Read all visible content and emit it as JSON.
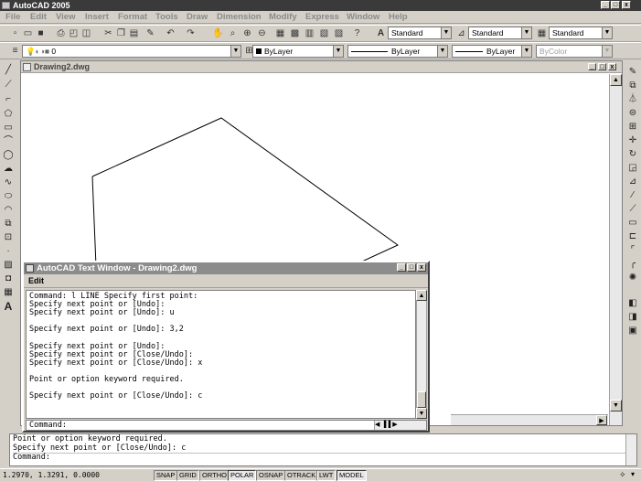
{
  "app": {
    "title": "AutoCAD 2005"
  },
  "menu": [
    "File",
    "Edit",
    "View",
    "Insert",
    "Format",
    "Tools",
    "Draw",
    "Dimension",
    "Modify",
    "Express",
    "Window",
    "Help"
  ],
  "styles_toolbar": {
    "text_style": "Standard",
    "dim_style": "Standard",
    "table_style": "Standard"
  },
  "layers_toolbar": {
    "layer": "0"
  },
  "properties_toolbar": {
    "color": "ByLayer",
    "linetype": "ByLayer",
    "lineweight": "ByLayer",
    "plotstyle": "ByColor"
  },
  "drawing": {
    "title": "Drawing2.dwg"
  },
  "text_window": {
    "title": "AutoCAD Text Window - Drawing2.dwg",
    "menu_edit": "Edit",
    "history": "Command: l LINE Specify first point:\nSpecify next point or [Undo]:\nSpecify next point or [Undo]: u\n\nSpecify next point or [Undo]: 3,2\n\nSpecify next point or [Undo]:\nSpecify next point or [Close/Undo]:\nSpecify next point or [Close/Undo]: x\n\nPoint or option keyword required.\n\nSpecify next point or [Close/Undo]: c",
    "prompt": "Command:"
  },
  "command_line": {
    "line1": "Point or option keyword required.",
    "line2": "Specify next point or [Close/Undo]: c",
    "prompt": "Command:"
  },
  "status": {
    "coords": "1.2970, 1.3291, 0.0000",
    "buttons": [
      "SNAP",
      "GRID",
      "ORTHO",
      "POLAR",
      "OSNAP",
      "OTRACK",
      "LWT",
      "MODEL"
    ],
    "active": [
      "POLAR",
      "MODEL"
    ]
  },
  "icons": {
    "draw_tools": [
      "line-icon",
      "construction-line-icon",
      "polyline-icon",
      "polygon-icon",
      "rectangle-icon",
      "arc-icon",
      "circle-icon",
      "revision-cloud-icon",
      "spline-icon",
      "ellipse-icon",
      "ellipse-arc-icon",
      "insert-block-icon",
      "make-block-icon",
      "point-icon",
      "hatch-icon",
      "region-icon",
      "table-icon",
      "multiline-text-icon"
    ],
    "modify_tools": [
      "erase-icon",
      "copy-icon",
      "mirror-icon",
      "offset-icon",
      "array-icon",
      "move-icon",
      "rotate-icon",
      "scale-icon",
      "stretch-icon",
      "trim-icon",
      "extend-icon",
      "break-icon",
      "join-icon",
      "chamfer-icon",
      "fillet-icon",
      "explode-icon"
    ]
  }
}
